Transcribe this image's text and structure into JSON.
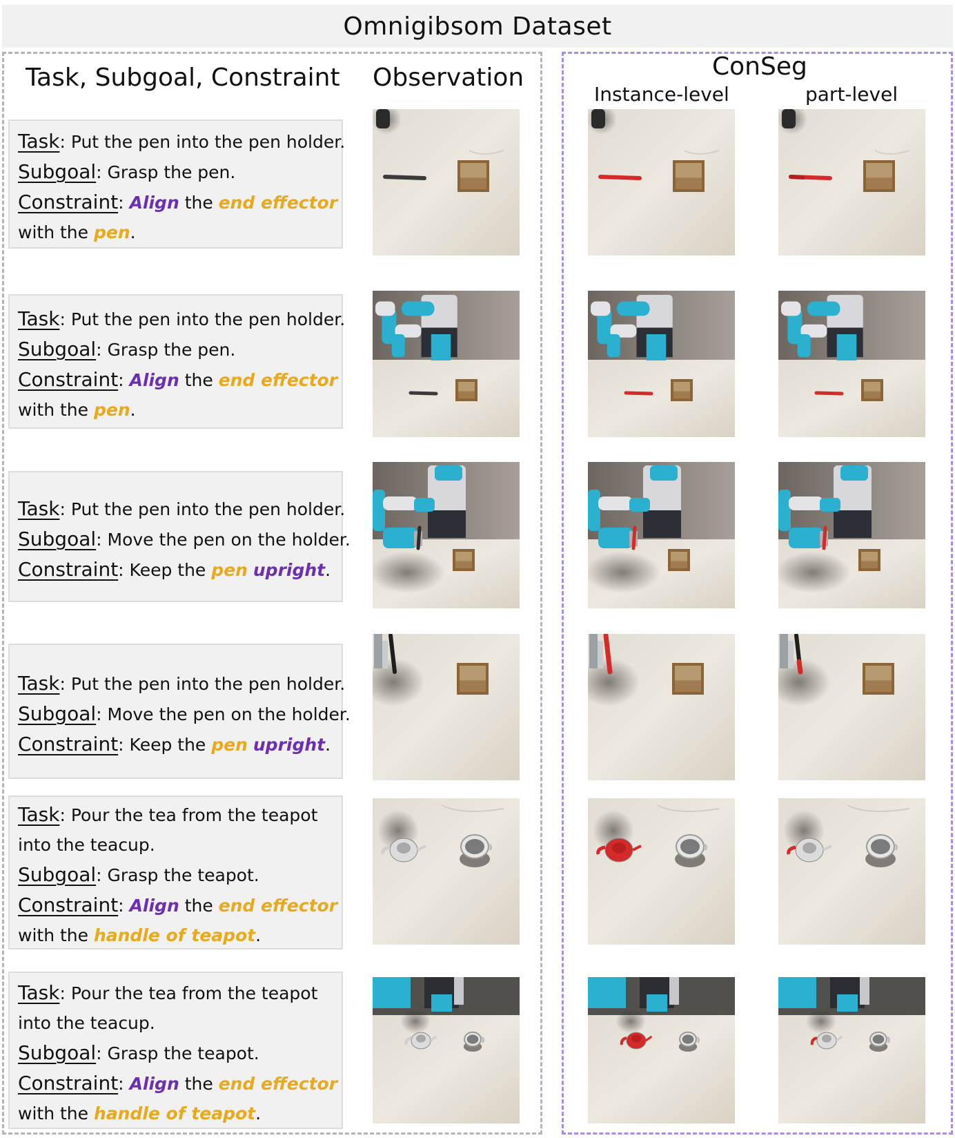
{
  "title": "Omnigibsom Dataset",
  "headers": {
    "left": "Task, Subgoal, Constraint",
    "observation": "Observation",
    "conseg": "ConSeg",
    "instance": "Instance-level",
    "part": "part-level"
  },
  "labels": {
    "task": "Task",
    "subgoal": "Subgoal",
    "constraint": "Constraint",
    "colon": ":"
  },
  "colors": {
    "highlight_yellow": "#e8a91c",
    "highlight_purple": "#6b2fb0",
    "mask_red": "#d42a2a",
    "robot_cyan": "#2bb0cf"
  },
  "rows": [
    {
      "task": [
        " Put the pen into the pen holder."
      ],
      "subgoal": " Grasp the pen.",
      "constraint_line1": [
        {
          "t": " "
        },
        {
          "t": "Align",
          "c": "p"
        },
        {
          "t": " the "
        },
        {
          "t": "end effector",
          "c": "y"
        }
      ],
      "constraint_line2": [
        {
          "t": "with the "
        },
        {
          "t": "pen",
          "c": "y"
        },
        {
          "t": "."
        }
      ],
      "scene": "pen-top"
    },
    {
      "task": [
        " Put the pen into the pen holder."
      ],
      "subgoal": " Grasp the pen.",
      "constraint_line1": [
        {
          "t": " "
        },
        {
          "t": "Align",
          "c": "p"
        },
        {
          "t": " the "
        },
        {
          "t": "end effector",
          "c": "y"
        }
      ],
      "constraint_line2": [
        {
          "t": "with the "
        },
        {
          "t": "pen",
          "c": "y"
        },
        {
          "t": "."
        }
      ],
      "scene": "pen-robot"
    },
    {
      "task": [
        " Put the pen into the pen holder."
      ],
      "subgoal": " Move the pen on the holder.",
      "constraint_line1": [
        {
          "t": " Keep the "
        },
        {
          "t": "pen",
          "c": "y"
        },
        {
          "t": " "
        },
        {
          "t": "upright",
          "c": "p"
        },
        {
          "t": "."
        }
      ],
      "constraint_line2": [],
      "scene": "pen-move"
    },
    {
      "task": [
        " Put the pen into the pen holder."
      ],
      "subgoal": " Move the pen on the holder.",
      "constraint_line1": [
        {
          "t": " Keep the "
        },
        {
          "t": "pen",
          "c": "y"
        },
        {
          "t": " "
        },
        {
          "t": "upright",
          "c": "p"
        },
        {
          "t": "."
        }
      ],
      "constraint_line2": [],
      "scene": "pen-upright"
    },
    {
      "task": [
        " Pour the tea from the teapot",
        "into the teacup."
      ],
      "subgoal": " Grasp the teapot.",
      "constraint_line1": [
        {
          "t": " "
        },
        {
          "t": "Align",
          "c": "p"
        },
        {
          "t": " the "
        },
        {
          "t": "end effector",
          "c": "y"
        }
      ],
      "constraint_line2": [
        {
          "t": "with the "
        },
        {
          "t": "handle of teapot",
          "c": "y"
        },
        {
          "t": "."
        }
      ],
      "scene": "teapot-top"
    },
    {
      "task": [
        " Pour the tea from the teapot",
        "into the teacup."
      ],
      "subgoal": " Grasp the teapot.",
      "constraint_line1": [
        {
          "t": " "
        },
        {
          "t": "Align",
          "c": "p"
        },
        {
          "t": " the "
        },
        {
          "t": "end effector",
          "c": "y"
        }
      ],
      "constraint_line2": [
        {
          "t": "with the "
        },
        {
          "t": "handle of teapot",
          "c": "y"
        },
        {
          "t": "."
        }
      ],
      "scene": "teapot-robot"
    }
  ]
}
